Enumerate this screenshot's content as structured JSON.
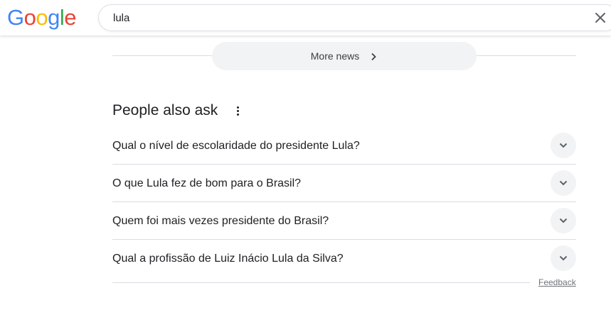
{
  "header": {
    "logo": {
      "letters": [
        "G",
        "o",
        "o",
        "g",
        "l",
        "e"
      ],
      "colors": [
        "#4285F4",
        "#EA4335",
        "#FBBC05",
        "#4285F4",
        "#34A853",
        "#EA4335"
      ]
    },
    "search": {
      "value": "lula",
      "clear_icon": "close-icon"
    }
  },
  "news": {
    "more_news_label": "More news",
    "chevron_icon": "chevron-right-icon"
  },
  "people_also_ask": {
    "title": "People also ask",
    "menu_icon": "more-vert-icon",
    "questions": [
      {
        "text": "Qual o nível de escolaridade do presidente Lula?",
        "icon": "chevron-down-icon"
      },
      {
        "text": "O que Lula fez de bom para o Brasil?",
        "icon": "chevron-down-icon"
      },
      {
        "text": "Quem foi mais vezes presidente do Brasil?",
        "icon": "chevron-down-icon"
      },
      {
        "text": "Qual a profissão de Luiz Inácio Lula da Silva?",
        "icon": "chevron-down-icon"
      }
    ],
    "feedback_label": "Feedback"
  }
}
